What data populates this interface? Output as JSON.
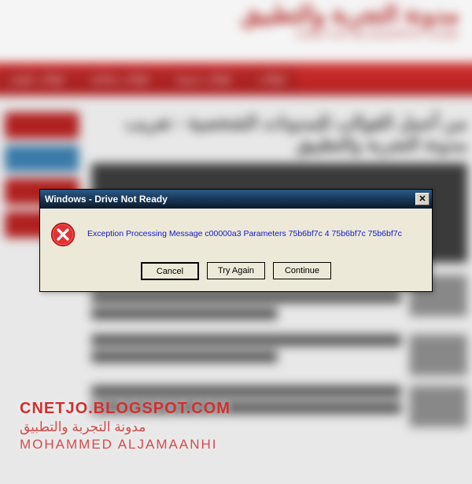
{
  "dialog": {
    "title": "Windows - Drive Not Ready",
    "message": "Exception Processing Message c00000a3 Parameters 75b6bf7c 4 75b6bf7c 75b6bf7c",
    "close_label": "✕",
    "buttons": {
      "cancel": "Cancel",
      "try_again": "Try Again",
      "continue": "Continue"
    }
  },
  "background": {
    "site_title": "مدونة التجربة والتطبيق",
    "site_url": "CNETJO.BLOGSPOT.COM",
    "nav": [
      "قوالب بلوجر",
      "قوالب مجانية",
      "قوالب مدونة",
      "قوالب"
    ],
    "post_title": "من أجمل القوالب للمدونات الشخصية - تعريب مدونة التجربة والتطبيق"
  },
  "watermark": {
    "line1": "CNETJO.BLOGSPOT.COM",
    "line2": "مدونة التجربة والتطبيق",
    "line3": "MOHAMMED ALJAMAANHI"
  }
}
